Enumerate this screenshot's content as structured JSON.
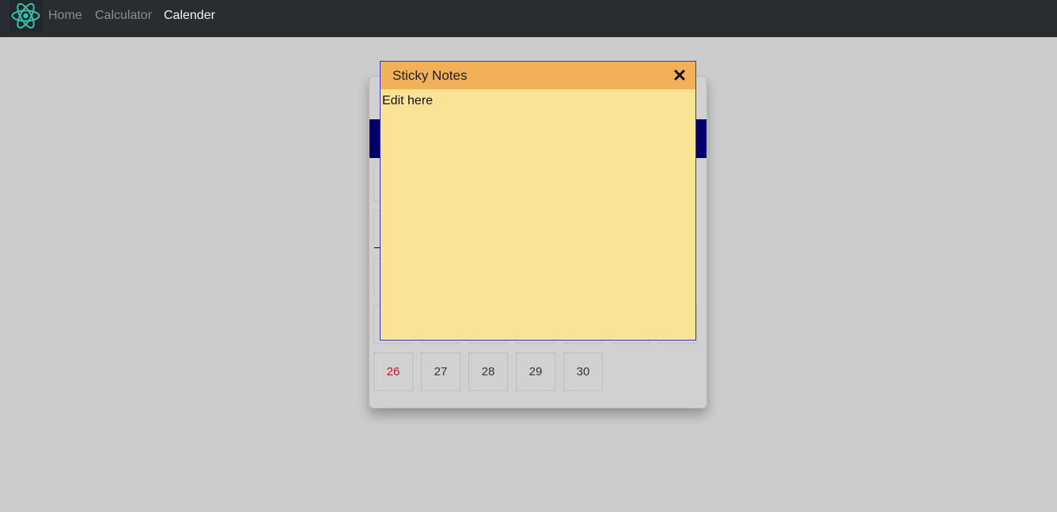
{
  "navbar": {
    "logo_icon": "react-atom-icon",
    "links": [
      {
        "label": "Home",
        "active": false
      },
      {
        "label": "Calculator",
        "active": false
      },
      {
        "label": "Calender",
        "active": true
      }
    ]
  },
  "sticky_note": {
    "title": "Sticky Notes",
    "close_icon": "close-icon",
    "body_text": "Edit here",
    "colors": {
      "header": "#f2b158",
      "body": "#fbe395",
      "border": "#3a36c9"
    }
  },
  "calendar": {
    "visible_days": [
      {
        "label": "26",
        "weekend": true
      },
      {
        "label": "27",
        "weekend": false
      },
      {
        "label": "28",
        "weekend": false
      },
      {
        "label": "29",
        "weekend": false
      },
      {
        "label": "30",
        "weekend": false
      }
    ],
    "colors": {
      "month_bar": "#02006b",
      "weekend_text": "#c8102e"
    }
  }
}
